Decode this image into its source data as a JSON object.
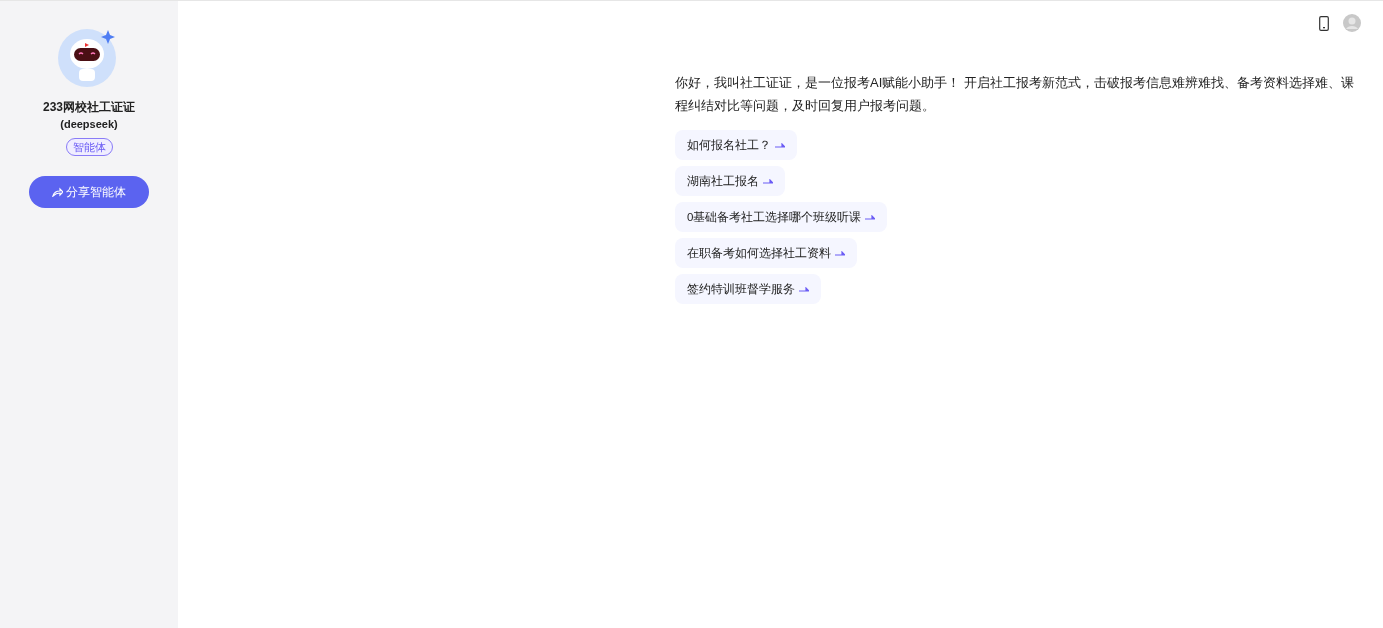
{
  "agent": {
    "name": "233网校社工证证",
    "model": "(deepseek)",
    "badge": "智能体",
    "share_button": "分享智能体"
  },
  "greeting": "你好，我叫社工证证，是一位报考AI赋能小助手！ 开启社工报考新范式，击破报考信息难辨难找、备考资料选择难、课程纠结对比等问题，及时回复用户报考问题。",
  "suggestions": [
    {
      "label": "如何报名社工？"
    },
    {
      "label": "湖南社工报名"
    },
    {
      "label": "0基础备考社工选择哪个班级听课"
    },
    {
      "label": "在职备考如何选择社工资料"
    },
    {
      "label": "签约特训班督学服务"
    }
  ]
}
